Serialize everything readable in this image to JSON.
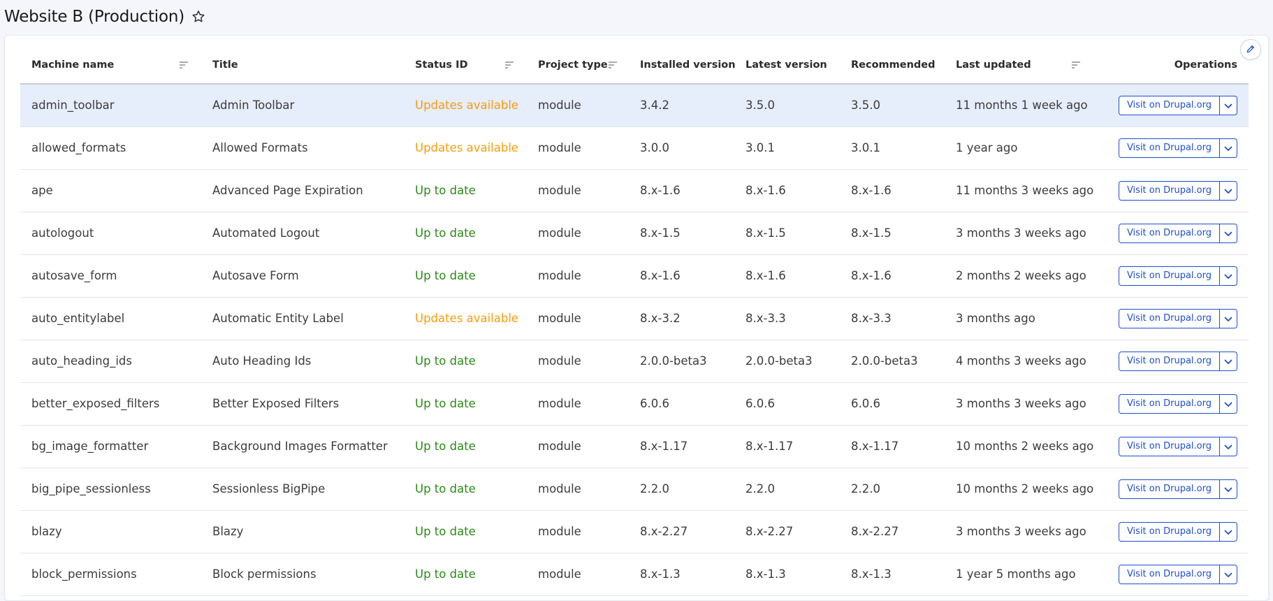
{
  "page": {
    "title": "Website B (Production)",
    "star_icon": "star-outline-icon",
    "edit_icon": "pencil-icon",
    "accent_color": "#1e4fc8",
    "status_colors": {
      "updates_available": "#f59e0b",
      "up_to_date": "#2b8a17"
    }
  },
  "table": {
    "headers": {
      "machine_name": "Machine name",
      "title": "Title",
      "status_id": "Status ID",
      "project_type": "Project type",
      "installed_version": "Installed version",
      "latest_version": "Latest version",
      "recommended": "Recommended",
      "last_updated": "Last updated",
      "operations": "Operations"
    },
    "sortable_icon": "sort-lines-icon",
    "rows": [
      {
        "machine_name": "admin_toolbar",
        "title": "Admin Toolbar",
        "status": "Updates available",
        "status_kind": "updates",
        "project_type": "module",
        "installed": "3.4.2",
        "latest": "3.5.0",
        "recommended": "3.5.0",
        "last_updated": "11 months 1 week ago",
        "operation": "Visit on Drupal.org",
        "selected": true
      },
      {
        "machine_name": "allowed_formats",
        "title": "Allowed Formats",
        "status": "Updates available",
        "status_kind": "updates",
        "project_type": "module",
        "installed": "3.0.0",
        "latest": "3.0.1",
        "recommended": "3.0.1",
        "last_updated": "1 year ago",
        "operation": "Visit on Drupal.org",
        "selected": false
      },
      {
        "machine_name": "ape",
        "title": "Advanced Page Expiration",
        "status": "Up to date",
        "status_kind": "ok",
        "project_type": "module",
        "installed": "8.x-1.6",
        "latest": "8.x-1.6",
        "recommended": "8.x-1.6",
        "last_updated": "11 months 3 weeks ago",
        "operation": "Visit on Drupal.org",
        "selected": false
      },
      {
        "machine_name": "autologout",
        "title": "Automated Logout",
        "status": "Up to date",
        "status_kind": "ok",
        "project_type": "module",
        "installed": "8.x-1.5",
        "latest": "8.x-1.5",
        "recommended": "8.x-1.5",
        "last_updated": "3 months 3 weeks ago",
        "operation": "Visit on Drupal.org",
        "selected": false
      },
      {
        "machine_name": "autosave_form",
        "title": "Autosave Form",
        "status": "Up to date",
        "status_kind": "ok",
        "project_type": "module",
        "installed": "8.x-1.6",
        "latest": "8.x-1.6",
        "recommended": "8.x-1.6",
        "last_updated": "2 months 2 weeks ago",
        "operation": "Visit on Drupal.org",
        "selected": false
      },
      {
        "machine_name": "auto_entitylabel",
        "title": "Automatic Entity Label",
        "status": "Updates available",
        "status_kind": "updates",
        "project_type": "module",
        "installed": "8.x-3.2",
        "latest": "8.x-3.3",
        "recommended": "8.x-3.3",
        "last_updated": "3 months ago",
        "operation": "Visit on Drupal.org",
        "selected": false
      },
      {
        "machine_name": "auto_heading_ids",
        "title": "Auto Heading Ids",
        "status": "Up to date",
        "status_kind": "ok",
        "project_type": "module",
        "installed": "2.0.0-beta3",
        "latest": "2.0.0-beta3",
        "recommended": "2.0.0-beta3",
        "last_updated": "4 months 3 weeks ago",
        "operation": "Visit on Drupal.org",
        "selected": false
      },
      {
        "machine_name": "better_exposed_filters",
        "title": "Better Exposed Filters",
        "status": "Up to date",
        "status_kind": "ok",
        "project_type": "module",
        "installed": "6.0.6",
        "latest": "6.0.6",
        "recommended": "6.0.6",
        "last_updated": "3 months 3 weeks ago",
        "operation": "Visit on Drupal.org",
        "selected": false
      },
      {
        "machine_name": "bg_image_formatter",
        "title": "Background Images Formatter",
        "status": "Up to date",
        "status_kind": "ok",
        "project_type": "module",
        "installed": "8.x-1.17",
        "latest": "8.x-1.17",
        "recommended": "8.x-1.17",
        "last_updated": "10 months 2 weeks ago",
        "operation": "Visit on Drupal.org",
        "selected": false
      },
      {
        "machine_name": "big_pipe_sessionless",
        "title": "Sessionless BigPipe",
        "status": "Up to date",
        "status_kind": "ok",
        "project_type": "module",
        "installed": "2.2.0",
        "latest": "2.2.0",
        "recommended": "2.2.0",
        "last_updated": "10 months 2 weeks ago",
        "operation": "Visit on Drupal.org",
        "selected": false
      },
      {
        "machine_name": "blazy",
        "title": "Blazy",
        "status": "Up to date",
        "status_kind": "ok",
        "project_type": "module",
        "installed": "8.x-2.27",
        "latest": "8.x-2.27",
        "recommended": "8.x-2.27",
        "last_updated": "3 months 3 weeks ago",
        "operation": "Visit on Drupal.org",
        "selected": false
      },
      {
        "machine_name": "block_permissions",
        "title": "Block permissions",
        "status": "Up to date",
        "status_kind": "ok",
        "project_type": "module",
        "installed": "8.x-1.3",
        "latest": "8.x-1.3",
        "recommended": "8.x-1.3",
        "last_updated": "1 year 5 months ago",
        "operation": "Visit on Drupal.org",
        "selected": false
      }
    ]
  }
}
